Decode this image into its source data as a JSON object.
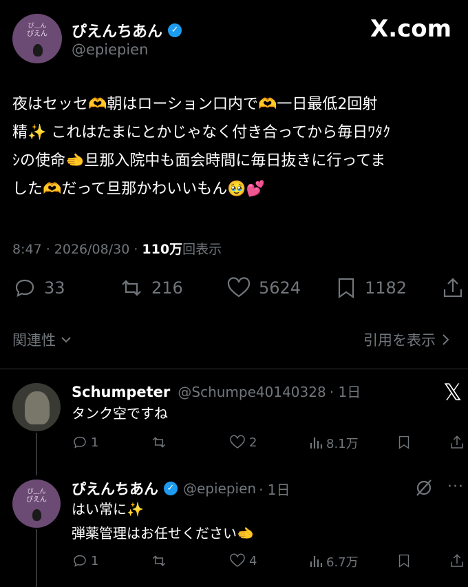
{
  "main_tweet": {
    "author_name": "ぴえんちあん",
    "handle": "@epiepien",
    "avatar_text": "ぴえん",
    "brand": "X.com",
    "text_lines": [
      "夜はセッセ🫶朝はローション口内で🫶一日最低2回射",
      "精✨ これはたまにとかじゃなく付き合ってから毎日ﾜﾀｸ",
      "ｼの使命🫲旦那入院中も面会時間に毎日抜きに行ってま",
      "した🫶だって旦那かわいいもん🥹💕"
    ],
    "time": "8:47 · 2026/08/30 · ",
    "views": "110万",
    "views_label": "回表示",
    "replies": "33",
    "retweets": "216",
    "likes": "5624",
    "bookmarks": "1182",
    "related": "関連性",
    "quote_link": "引用を表示"
  },
  "replies": [
    {
      "name": "Schumpeter",
      "handle": "@Schumpe40140328",
      "time": "· 1日",
      "text_lines": [
        "タンク空ですね"
      ],
      "reply_count": "1",
      "like_count": "2",
      "views": "8.1万"
    },
    {
      "name": "ぴえんちあん",
      "handle": "@epiepien",
      "time": "· 1日",
      "text_lines": [
        "はい常に✨",
        "弾薬管理はお任せください🫲"
      ],
      "reply_count": "1",
      "like_count": "4",
      "views": "6.7万",
      "avatar_text": "ぴえん"
    }
  ],
  "icons": {
    "verified": "verified-badge-icon",
    "x_logo": "x-logo-icon"
  }
}
